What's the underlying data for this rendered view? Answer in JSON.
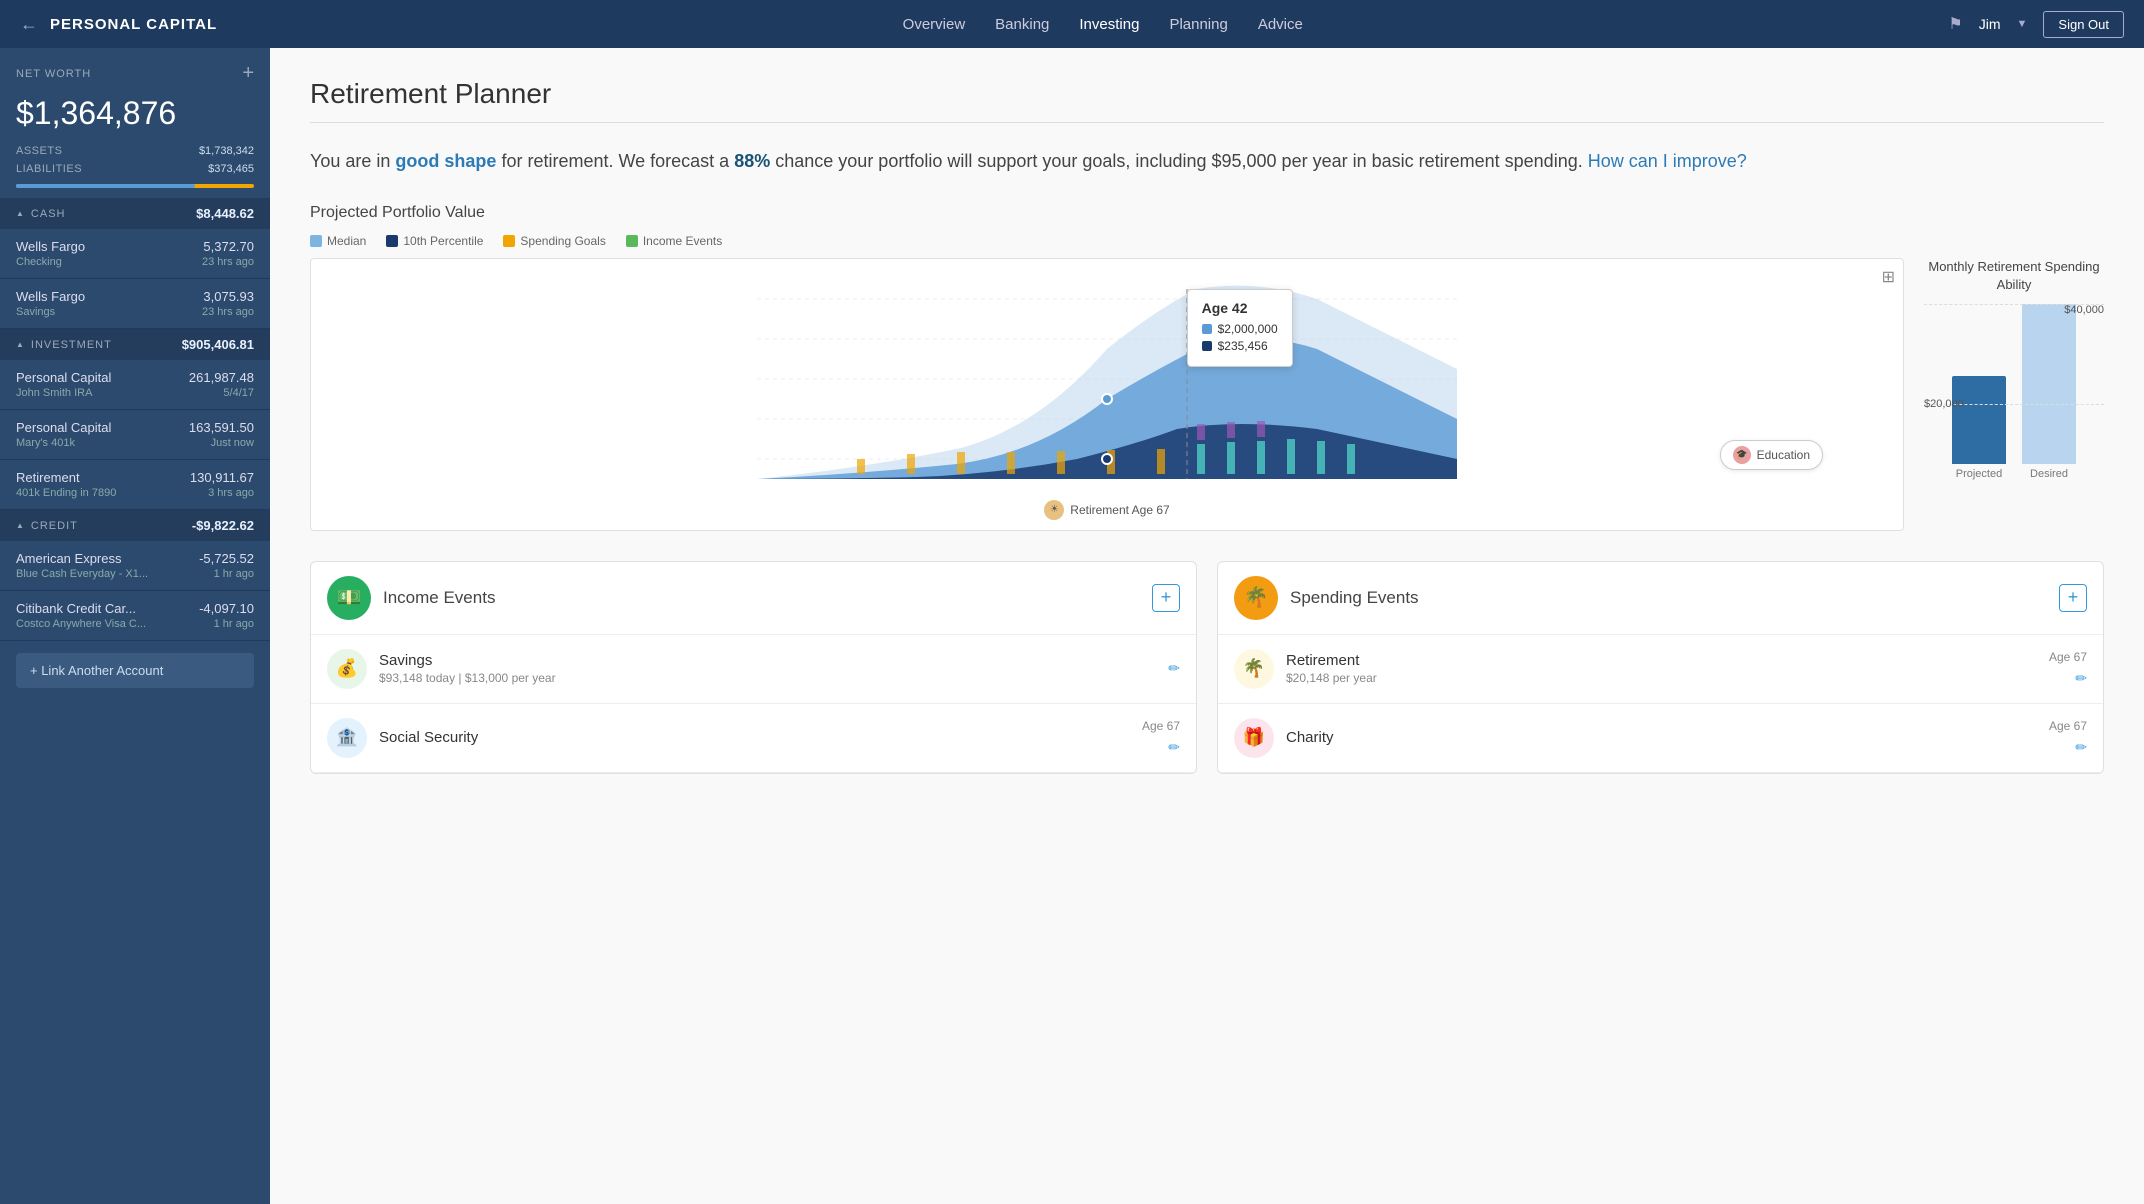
{
  "topnav": {
    "brand": "PERSONAL CAPITAL",
    "back_label": "←",
    "nav_links": [
      "Overview",
      "Banking",
      "Investing",
      "Planning",
      "Advice"
    ],
    "active_nav": "Investing",
    "flag_icon": "⚑",
    "user_name": "Jim",
    "signout_label": "Sign Out"
  },
  "sidebar": {
    "net_worth_label": "NET WORTH",
    "net_worth_value": "$1,364,876",
    "plus_label": "+",
    "assets_label": "ASSETS",
    "assets_value": "$1,738,342",
    "liabilities_label": "LIABILITIES",
    "liabilities_value": "$373,465",
    "sections": [
      {
        "label": "CASH",
        "total": "$8,448.62",
        "expanded": true,
        "accounts": [
          {
            "name": "Wells Fargo",
            "sub": "Checking",
            "value": "5,372.70",
            "time": "23 hrs ago"
          },
          {
            "name": "Wells Fargo",
            "sub": "Savings",
            "value": "3,075.93",
            "time": "23 hrs ago"
          }
        ]
      },
      {
        "label": "INVESTMENT",
        "total": "$905,406.81",
        "expanded": true,
        "accounts": [
          {
            "name": "Personal Capital",
            "sub": "John Smith IRA",
            "value": "261,987.48",
            "time": "5/4/17"
          },
          {
            "name": "Personal Capital",
            "sub": "Mary's 401k",
            "value": "163,591.50",
            "time": "Just now"
          },
          {
            "name": "Retirement",
            "sub": "401k Ending in 7890",
            "value": "130,911.67",
            "time": "3 hrs ago"
          }
        ]
      },
      {
        "label": "CREDIT",
        "total": "-$9,822.62",
        "expanded": true,
        "accounts": [
          {
            "name": "American Express",
            "sub": "Blue Cash Everyday - X1...",
            "value": "-5,725.52",
            "time": "1 hr ago"
          },
          {
            "name": "Citibank Credit Car...",
            "sub": "Costco Anywhere Visa C...",
            "value": "-4,097.10",
            "time": "1 hr ago"
          }
        ]
      }
    ],
    "link_account_label": "+ Link Another Account"
  },
  "content": {
    "page_title": "Retirement Planner",
    "forecast_text_prefix": "You are in ",
    "forecast_highlight_good": "good shape",
    "forecast_text_mid": " for retirement. We forecast a ",
    "forecast_highlight_percent": "88%",
    "forecast_text_end": " chance your portfolio will support your goals, including $95,000 per year in basic retirement spending.",
    "forecast_improve_link": "How can I improve?",
    "chart_title": "Projected Portfolio Value",
    "chart_legend": [
      {
        "label": "Median",
        "color": "#7eb5e0"
      },
      {
        "label": "10th Percentile",
        "color": "#1a3a6e"
      },
      {
        "label": "Spending Goals",
        "color": "#f0a500"
      },
      {
        "label": "Income Events",
        "color": "#5cb85c"
      }
    ],
    "chart_tooltip": {
      "age": "Age 42",
      "values": [
        {
          "label": "$2,000,000",
          "color": "#5b9bd5"
        },
        {
          "label": "$235,456",
          "color": "#1a3a6e"
        }
      ]
    },
    "education_label": "Education",
    "retirement_label": "Retirement Age 67",
    "monthly_chart": {
      "title": "Monthly Retirement Spending Ability",
      "projected_label": "Projected",
      "desired_label": "Desired",
      "projected_value": "$20,000",
      "desired_value": "$40,000",
      "projected_height_pct": 50,
      "desired_height_pct": 100
    },
    "income_events": {
      "title": "Income Events",
      "add_label": "+",
      "items": [
        {
          "name": "Savings",
          "detail": "$93,148 today | $13,000 per year",
          "icon": "💰",
          "icon_class": "event-savings-icon"
        },
        {
          "name": "Social Security",
          "detail": "",
          "age": "Age  67",
          "icon": "🏦",
          "icon_class": "event-social-icon"
        }
      ]
    },
    "spending_events": {
      "title": "Spending Events",
      "add_label": "+",
      "items": [
        {
          "name": "Retirement",
          "detail": "$20,148 per year",
          "age": "Age  67",
          "icon": "🌴",
          "icon_class": "event-retirement-icon"
        },
        {
          "name": "Charity",
          "detail": "",
          "age": "Age  67",
          "icon": "🎁",
          "icon_class": "event-charity-icon"
        }
      ]
    }
  }
}
